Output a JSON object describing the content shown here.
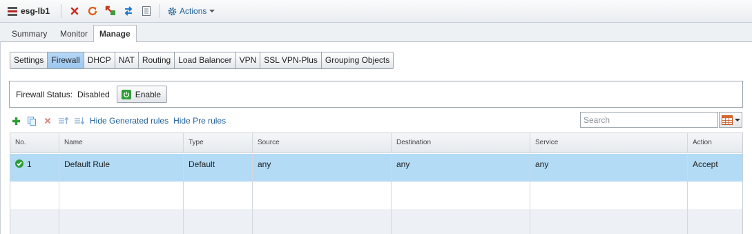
{
  "header": {
    "object_name": "esg-lb1",
    "actions_label": "Actions",
    "toolbar_icons": [
      "edge-icon",
      "delete-icon",
      "refresh-icon",
      "deploy-icon",
      "migrate-icon",
      "log-icon",
      "gear-icon"
    ]
  },
  "main_tabs": [
    {
      "label": "Summary",
      "active": false
    },
    {
      "label": "Monitor",
      "active": false
    },
    {
      "label": "Manage",
      "active": true
    }
  ],
  "sub_tabs": [
    {
      "label": "Settings",
      "active": false
    },
    {
      "label": "Firewall",
      "active": true
    },
    {
      "label": "DHCP",
      "active": false
    },
    {
      "label": "NAT",
      "active": false
    },
    {
      "label": "Routing",
      "active": false
    },
    {
      "label": "Load Balancer",
      "active": false
    },
    {
      "label": "VPN",
      "active": false
    },
    {
      "label": "SSL VPN-Plus",
      "active": false
    },
    {
      "label": "Grouping Objects",
      "active": false
    }
  ],
  "firewall": {
    "status_label": "Firewall Status:",
    "status_value": "Disabled",
    "enable_label": "Enable"
  },
  "grid_toolbar": {
    "hide_generated_label": "Hide Generated rules",
    "hide_pre_label": "Hide Pre rules",
    "search_placeholder": "Search"
  },
  "table": {
    "columns": [
      "No.",
      "Name",
      "Type",
      "Source",
      "Destination",
      "Service",
      "Action"
    ],
    "rows": [
      {
        "no": "1",
        "name": "Default Rule",
        "type": "Default",
        "source": "any",
        "destination": "any",
        "service": "any",
        "action": "Accept"
      }
    ]
  },
  "colors": {
    "accent_link": "#1d5e98",
    "selected_row": "#b3dbf5",
    "active_subtab": "#9cc7ee",
    "enabled_green": "#2e9d35"
  }
}
